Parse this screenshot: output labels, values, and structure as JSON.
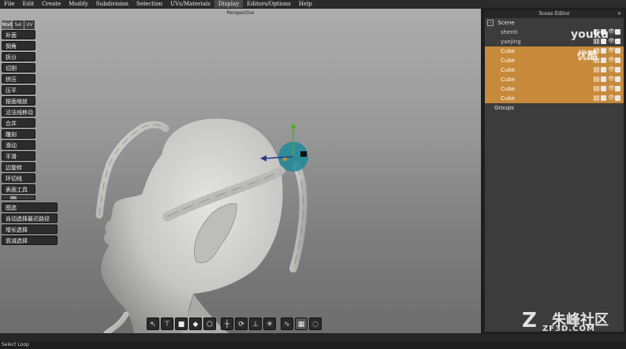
{
  "menubar": [
    "File",
    "Edit",
    "Create",
    "Modify",
    "Subdivision",
    "Selection",
    "UVs/Materials",
    "Display",
    "Editors/Options",
    "Help"
  ],
  "viewport": {
    "title": "Perspective"
  },
  "sidepanel": {
    "tabs": [
      "Mod",
      "Sel",
      "UV"
    ],
    "tools_a": [
      "补面",
      "倒角",
      "拆分",
      "切割",
      "挤压",
      "压平",
      "按面缩放",
      "沿法线移动",
      "合并",
      "雕刻",
      "滑动",
      "平滑",
      "边旋转",
      "环切线",
      "表面工具"
    ],
    "tools_b": [
      "图选",
      "自动选择最近路径",
      "增长选择",
      "衰减选择"
    ]
  },
  "scene_editor": {
    "title": "Scene Editor",
    "close": "×",
    "root": "Scene",
    "items": [
      {
        "label": "shenti",
        "selected": false
      },
      {
        "label": "yanjing",
        "selected": false
      },
      {
        "label": "Cube",
        "selected": true
      },
      {
        "label": "Cube",
        "selected": true
      },
      {
        "label": "Cube",
        "selected": true
      },
      {
        "label": "Cube",
        "selected": true
      },
      {
        "label": "Cube",
        "selected": true
      },
      {
        "label": "Cube",
        "selected": true
      }
    ],
    "groups": "Groups"
  },
  "toolbar": {
    "icons": [
      "select-icon",
      "move-face-icon",
      "cube-solid-icon",
      "cube-shaded-icon",
      "cube-wire-icon",
      "move-gizmo-icon",
      "rotate-gizmo-icon",
      "scale-gizmo-icon",
      "universal-gizmo-icon",
      "soft-select-icon",
      "frame-icon",
      "lasso-icon"
    ]
  },
  "status": "Select Loop",
  "watermarks": {
    "w1": "youku",
    "w2": "优酷",
    "w3": "朱峰社区",
    "w4": "ZF3D.COM",
    "logo": "Z"
  },
  "colors": {
    "selection": "#c78a3a",
    "gizmo": "#1e8a9a"
  }
}
